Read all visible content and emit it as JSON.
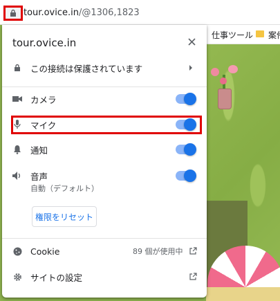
{
  "address_bar": {
    "url_host": "tour.ovice.in",
    "url_path": "/@1306,1823"
  },
  "bookmarks_bar": {
    "item1": "仕事ツール",
    "item2": "案件"
  },
  "popup": {
    "title": "tour.ovice.in",
    "connection": "この接続は保護されています",
    "permissions": [
      {
        "label": "カメラ",
        "icon": "camera-icon",
        "enabled": true
      },
      {
        "label": "マイク",
        "icon": "microphone-icon",
        "enabled": true
      },
      {
        "label": "通知",
        "icon": "bell-icon",
        "enabled": true
      },
      {
        "label": "音声",
        "icon": "speaker-icon",
        "enabled": true,
        "sub": "自動（デフォルト）"
      }
    ],
    "reset_label": "権限をリセット",
    "cookie_label": "Cookie",
    "cookie_meta": "89 個が使用中",
    "site_settings": "サイトの設定"
  },
  "colors": {
    "highlight": "#e00000",
    "toggle_on": "#1a73e8",
    "toggle_track": "#8ab4f8"
  }
}
